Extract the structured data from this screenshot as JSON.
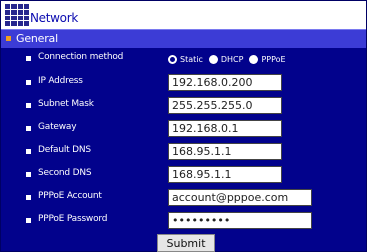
{
  "header": {
    "title": "Network",
    "logo": "network-logo-icon"
  },
  "section": {
    "title": "General"
  },
  "connection": {
    "label": "Connection method",
    "options": [
      {
        "label": "Static",
        "checked": true
      },
      {
        "label": "DHCP",
        "checked": false
      },
      {
        "label": "PPPoE",
        "checked": false
      }
    ]
  },
  "fields": {
    "ip_address": {
      "label": "IP Address",
      "value": "192.168.0.200"
    },
    "subnet_mask": {
      "label": "Subnet Mask",
      "value": "255.255.255.0"
    },
    "gateway": {
      "label": "Gateway",
      "value": "192.168.0.1"
    },
    "default_dns": {
      "label": "Default DNS",
      "value": "168.95.1.1"
    },
    "second_dns": {
      "label": "Second DNS",
      "value": "168.95.1.1"
    },
    "pppoe_account": {
      "label": "PPPoE Account",
      "value": "account@pppoe.com"
    },
    "pppoe_password": {
      "label": "PPPoE Password",
      "value": "•••••••••"
    }
  },
  "actions": {
    "submit_label": "Submit"
  },
  "colors": {
    "panel": "#02028c",
    "section": "#3c3cd6",
    "accent": "#f0a020"
  }
}
